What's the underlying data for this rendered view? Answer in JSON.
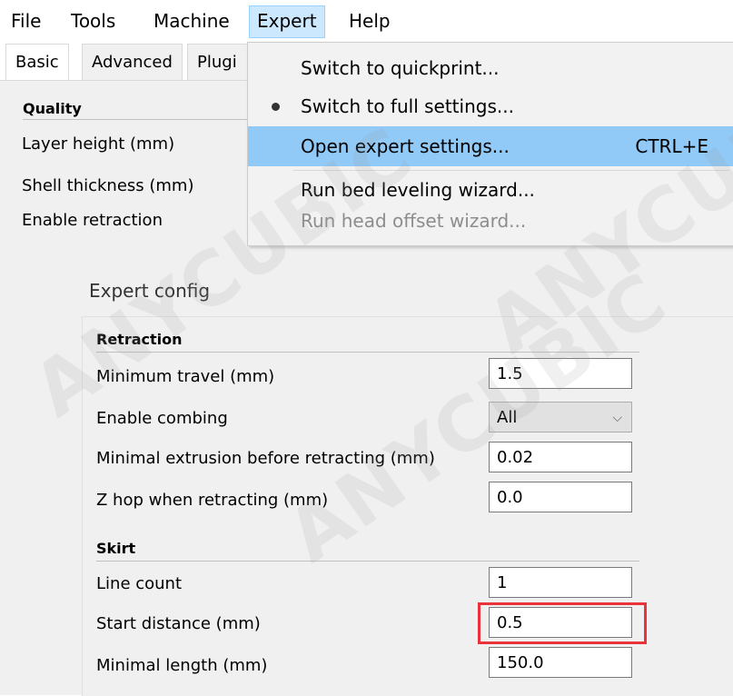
{
  "menubar": {
    "items": [
      "File",
      "Tools",
      "Machine",
      "Expert",
      "Help"
    ],
    "active": "Expert"
  },
  "tabs": [
    "Basic",
    "Advanced",
    "Plugi"
  ],
  "basic": {
    "section": "Quality",
    "labels": [
      "Layer height (mm)",
      "Shell thickness (mm)",
      "Enable retraction"
    ]
  },
  "expert_menu": {
    "items": [
      {
        "label": "Switch to quickprint...",
        "shortcut": ""
      },
      {
        "label": "Switch to full settings...",
        "shortcut": ""
      },
      {
        "label": "Open expert settings...",
        "shortcut": "CTRL+E"
      },
      {
        "label": "Run bed leveling wizard...",
        "shortcut": ""
      },
      {
        "label": "Run head offset wizard...",
        "shortcut": ""
      }
    ]
  },
  "expert_config": {
    "title": "Expert config",
    "retraction": {
      "section": "Retraction",
      "min_travel": {
        "label": "Minimum travel (mm)",
        "value": "1.5"
      },
      "combing": {
        "label": "Enable combing",
        "value": "All"
      },
      "min_extrusion": {
        "label": "Minimal extrusion before retracting (mm)",
        "value": "0.02"
      },
      "z_hop": {
        "label": "Z hop when retracting (mm)",
        "value": "0.0"
      }
    },
    "skirt": {
      "section": "Skirt",
      "line_count": {
        "label": "Line count",
        "value": "1"
      },
      "start_distance": {
        "label": "Start distance (mm)",
        "value": "0.5"
      },
      "minimal_length": {
        "label": "Minimal length (mm)",
        "value": "150.0"
      }
    }
  },
  "watermark": "ANYCUBIC",
  "colors": {
    "menu_highlight": "#91c9f7",
    "active_menu": "#cce8ff",
    "callout": "#e8333a"
  }
}
